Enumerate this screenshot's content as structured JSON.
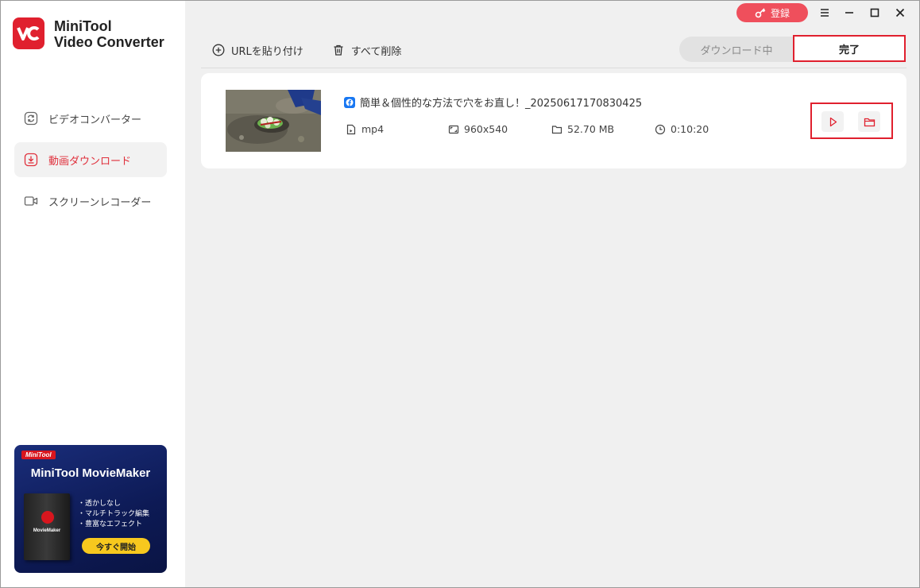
{
  "app": {
    "name_line1": "MiniTool",
    "name_line2": "Video Converter",
    "accent": "#e0202e"
  },
  "titlebar": {
    "register_label": "登録",
    "register_icon": "key-icon",
    "buttons": [
      "menu-icon",
      "minimize-icon",
      "maximize-icon",
      "close-icon"
    ]
  },
  "sidebar": {
    "items": [
      {
        "label": "ビデオコンバーター",
        "icon": "convert-icon",
        "active": false
      },
      {
        "label": "動画ダウンロード",
        "icon": "download-icon",
        "active": true
      },
      {
        "label": "スクリーンレコーダー",
        "icon": "camera-icon",
        "active": false
      }
    ]
  },
  "ad": {
    "brand": "MiniTool",
    "title": "MiniTool MovieMaker",
    "box_name": "MovieMaker",
    "bullets": [
      "・透かしなし",
      "・マルチトラック編集",
      "・豊富なエフェクト"
    ],
    "cta": "今すぐ開始"
  },
  "toolbar": {
    "paste_label": "URLを貼り付け",
    "delete_all_label": "すべて削除"
  },
  "tabs": {
    "downloading": "ダウンロード中",
    "done": "完了"
  },
  "item": {
    "title": "簡単＆個性的な方法で穴をお直し！_20250617170830425",
    "source_icon": "facebook-icon",
    "format": "mp4",
    "resolution": "960x540",
    "size": "52.70 MB",
    "duration": "0:10:20"
  }
}
